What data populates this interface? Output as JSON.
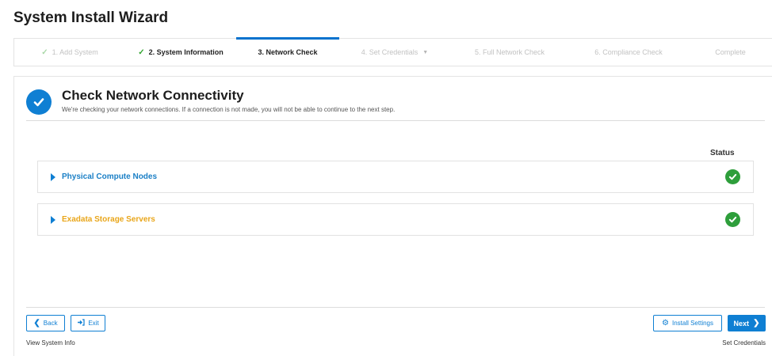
{
  "wizard": {
    "title": "System Install Wizard"
  },
  "steps": [
    {
      "label": "1. Add System",
      "state": "done-light"
    },
    {
      "label": "2. System Information",
      "state": "done"
    },
    {
      "label": "3. Network Check",
      "state": "active"
    },
    {
      "label": "4. Set Credentials",
      "state": "pending"
    },
    {
      "label": "5. Full Network Check",
      "state": "pending"
    },
    {
      "label": "6. Compliance Check",
      "state": "pending"
    },
    {
      "label": "Complete",
      "state": "pending"
    }
  ],
  "section": {
    "title": "Check Network Connectivity",
    "description": "We're checking your network connections. If a connection is not made, you will not be able to continue to the next step."
  },
  "table": {
    "status_header": "Status",
    "groups": [
      {
        "name": "Physical Compute Nodes",
        "color": "#1a7fc6",
        "status": "success"
      },
      {
        "name": "Exadata Storage Servers",
        "color": "#e9a61a",
        "status": "success"
      }
    ]
  },
  "footer": {
    "back_label": "Back",
    "exit_label": "Exit",
    "install_settings_label": "Install Settings",
    "next_label": "Next",
    "view_system_info": "View System Info",
    "next_step_caption": "Set Credentials"
  },
  "colors": {
    "accent": "#0f7fd3",
    "success": "#2e9e3b",
    "check_done": "#33a532"
  }
}
